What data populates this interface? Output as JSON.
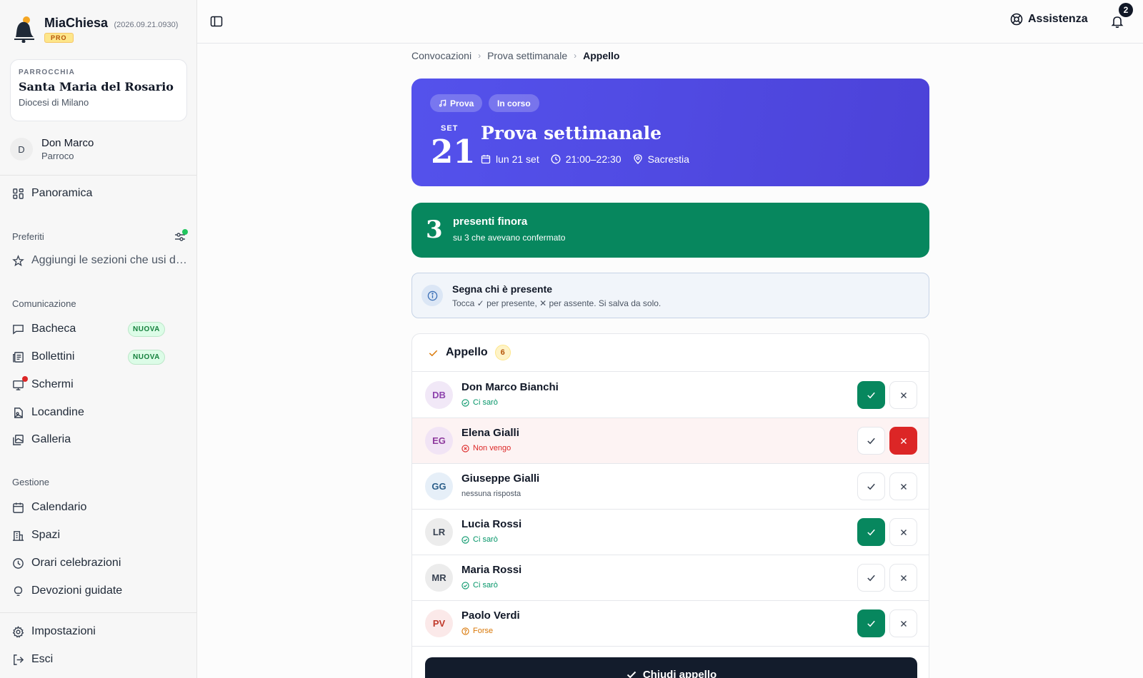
{
  "app": {
    "name": "MiaChiesa",
    "version": "(2026.09.21.0930)",
    "plan_badge": "PRO"
  },
  "parish": {
    "kicker": "PARROCCHIA",
    "name": "Santa Maria del Rosario",
    "diocese": "Diocesi di Milano"
  },
  "user": {
    "initial": "D",
    "name": "Don Marco",
    "role": "Parroco"
  },
  "sidebar": {
    "overview": "Panoramica",
    "favorites_label": "Preferiti",
    "favorites_hint": "Aggiungi le sezioni che usi di più",
    "communication_label": "Comunicazione",
    "communication_items": [
      {
        "label": "Bacheca",
        "badge": "NUOVA"
      },
      {
        "label": "Bollettini",
        "badge": "NUOVA"
      },
      {
        "label": "Schermi"
      },
      {
        "label": "Locandine"
      },
      {
        "label": "Galleria"
      }
    ],
    "management_label": "Gestione",
    "management_items": [
      {
        "label": "Calendario"
      },
      {
        "label": "Spazi"
      },
      {
        "label": "Orari celebrazioni"
      },
      {
        "label": "Devozioni guidate"
      }
    ],
    "settings": "Impostazioni",
    "logout": "Esci"
  },
  "topbar": {
    "help_label": "Assistenza",
    "notifications_count": "2"
  },
  "breadcrumb": [
    "Convocazioni",
    "Prova settimanale",
    "Appello"
  ],
  "event": {
    "type_pill": "Prova",
    "status_pill": "In corso",
    "month": "SET",
    "day": "21",
    "title": "Prova settimanale",
    "date": "lun 21 set",
    "time": "21:00–22:30",
    "place": "Sacrestia"
  },
  "summary": {
    "present_count": "3",
    "title": "presenti finora",
    "subtitle": "su 3 che avevano confermato"
  },
  "info": {
    "title": "Segna chi è presente",
    "subtitle": "Tocca ✓ per presente, ✕ per assente. Si salva da solo."
  },
  "roll": {
    "title": "Appello",
    "count": "6",
    "people": [
      {
        "initials": "DB",
        "name": "Don Marco Bianchi",
        "status": "Ci sarò",
        "status_kind": "yes",
        "mark": "present",
        "avatar_bg": "#f1e8f7",
        "avatar_fg": "#8e44ad"
      },
      {
        "initials": "EG",
        "name": "Elena Gialli",
        "status": "Non vengo",
        "status_kind": "no",
        "mark": "absent",
        "avatar_bg": "#f1e4f5",
        "avatar_fg": "#8e3a9d"
      },
      {
        "initials": "GG",
        "name": "Giuseppe Gialli",
        "status": "nessuna risposta",
        "status_kind": "none",
        "mark": "none",
        "avatar_bg": "#e6eff8",
        "avatar_fg": "#2c5f8a"
      },
      {
        "initials": "LR",
        "name": "Lucia Rossi",
        "status": "Ci sarò",
        "status_kind": "yes",
        "mark": "present",
        "avatar_bg": "#ececec",
        "avatar_fg": "#374151"
      },
      {
        "initials": "MR",
        "name": "Maria Rossi",
        "status": "Ci sarò",
        "status_kind": "yes",
        "mark": "none",
        "avatar_bg": "#ececec",
        "avatar_fg": "#374151"
      },
      {
        "initials": "PV",
        "name": "Paolo Verdi",
        "status": "Forse",
        "status_kind": "maybe",
        "mark": "present",
        "avatar_bg": "#fbe9e9",
        "avatar_fg": "#c0392b"
      }
    ],
    "close_label": "Chiudi appello"
  },
  "colors": {
    "hero": "#5452ec",
    "present_green": "#07875e",
    "absent_red": "#dc2626",
    "status_yes": "#059669",
    "status_no": "#dc2626",
    "status_maybe": "#d97706"
  },
  "icons": {
    "logo": "bell-logo",
    "sidebar_toggle": "sidebar-toggle-icon",
    "help": "lifebuoy-icon",
    "notifications": "bell-icon"
  }
}
